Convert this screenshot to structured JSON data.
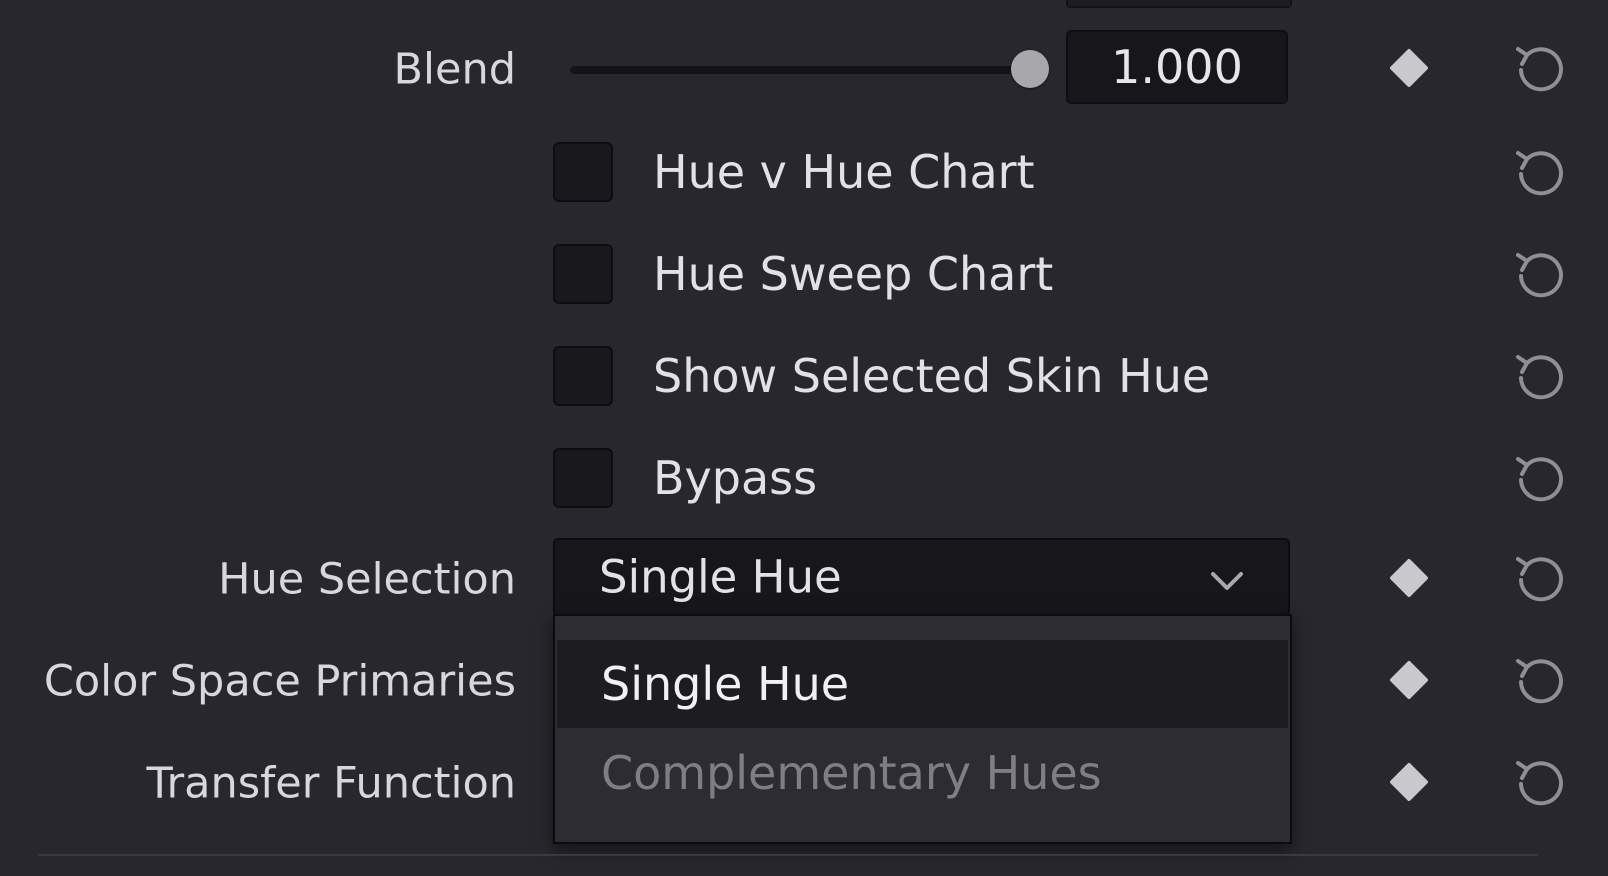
{
  "blend": {
    "label": "Blend",
    "value": "1.000",
    "slider_fraction": 1.0
  },
  "checkboxes": [
    {
      "label": "Hue v Hue Chart",
      "checked": false
    },
    {
      "label": "Hue Sweep Chart",
      "checked": false
    },
    {
      "label": "Show Selected Skin Hue",
      "checked": false
    },
    {
      "label": "Bypass",
      "checked": false
    }
  ],
  "hue_selection": {
    "label": "Hue Selection",
    "value": "Single Hue",
    "options": [
      "Single Hue",
      "Complementary Hues"
    ]
  },
  "color_space_primaries": {
    "label": "Color Space Primaries"
  },
  "transfer_function": {
    "label": "Transfer Function"
  },
  "icons": {
    "keyframe": "keyframe-diamond-icon",
    "reset": "reset-icon",
    "dropdown": "chevron-down-icon"
  },
  "colors": {
    "background": "#28272d",
    "field": "#17161b",
    "handle": "#a8a8ac",
    "text": "#d7d7dc",
    "muted_option": "#7f7e85"
  }
}
